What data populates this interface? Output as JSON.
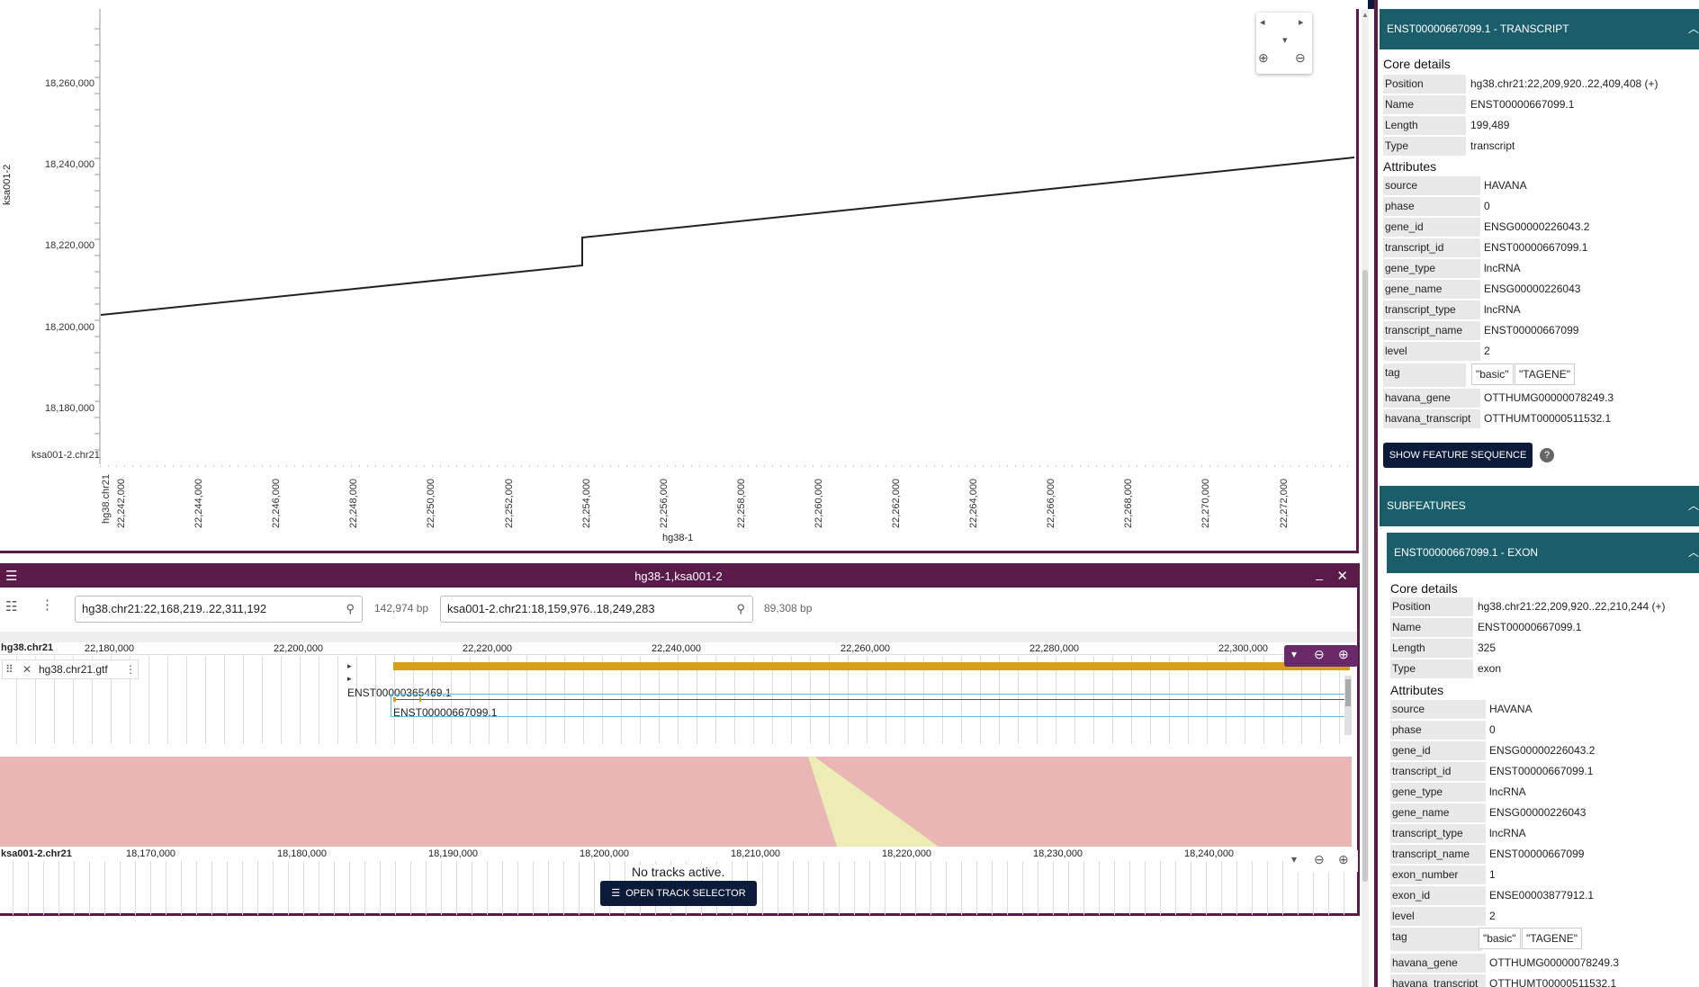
{
  "dotplot": {
    "y_axis_label": "ksa001-2",
    "y_ticks": [
      "18,260,000",
      "18,240,000",
      "18,220,000",
      "18,200,000",
      "18,180,000"
    ],
    "y_ref_label": "ksa001-2.chr21",
    "x_ref_label": "hg38.chr21",
    "x_ticks": [
      "22,242,000",
      "22,244,000",
      "22,246,000",
      "22,248,000",
      "22,250,000",
      "22,252,000",
      "22,254,000",
      "22,256,000",
      "22,258,000",
      "22,260,000",
      "22,262,000",
      "22,264,000",
      "22,266,000",
      "22,268,000",
      "22,270,000",
      "22,272,000"
    ],
    "x_axis_label": "hg38-1"
  },
  "lgv": {
    "title": "hg38-1,ksa001-2",
    "loc1": "hg38.chr21:22,168,219..22,311,192",
    "bp1": "142,974 bp",
    "loc2": "ksa001-2.chr21:18,159,976..18,249,283",
    "bp2": "89,308 bp",
    "top_ref": "hg38.chr21",
    "top_ticks": [
      "22,180,000",
      "22,200,000",
      "22,220,000",
      "22,240,000",
      "22,260,000",
      "22,280,000",
      "22,300,000"
    ],
    "track_name": "hg38.chr21.gtf",
    "feature1": "ENST00000365469.1",
    "feature2": "ENST00000667099.1",
    "bottom_ref": "ksa001-2.chr21",
    "bottom_ticks": [
      "18,170,000",
      "18,180,000",
      "18,190,000",
      "18,200,000",
      "18,210,000",
      "18,220,000",
      "18,230,000",
      "18,240,000"
    ],
    "no_tracks": "No tracks active.",
    "open_selector": "OPEN TRACK SELECTOR"
  },
  "panel": {
    "header1": "ENST00000667099.1 - TRANSCRIPT",
    "core_details": "Core details",
    "core": [
      {
        "k": "Position",
        "v": "hg38.chr21:22,209,920..22,409,408 (+)"
      },
      {
        "k": "Name",
        "v": "ENST00000667099.1"
      },
      {
        "k": "Length",
        "v": "199,489"
      },
      {
        "k": "Type",
        "v": "transcript"
      }
    ],
    "attributes": "Attributes",
    "attrs": [
      {
        "k": "source",
        "v": "HAVANA"
      },
      {
        "k": "phase",
        "v": "0"
      },
      {
        "k": "gene_id",
        "v": "ENSG00000226043.2"
      },
      {
        "k": "transcript_id",
        "v": "ENST00000667099.1"
      },
      {
        "k": "gene_type",
        "v": "lncRNA"
      },
      {
        "k": "gene_name",
        "v": "ENSG00000226043"
      },
      {
        "k": "transcript_type",
        "v": "lncRNA"
      },
      {
        "k": "transcript_name",
        "v": "ENST00000667099"
      },
      {
        "k": "level",
        "v": "2"
      }
    ],
    "tag_key": "tag",
    "tags": [
      "\"basic\"",
      "\"TAGENE\""
    ],
    "attrs2": [
      {
        "k": "havana_gene",
        "v": "OTTHUMG00000078249.3"
      },
      {
        "k": "havana_transcript",
        "v": "OTTHUMT00000511532.1"
      }
    ],
    "show_seq": "SHOW FEATURE SEQUENCE",
    "subfeatures": "SUBFEATURES",
    "exon_header": "ENST00000667099.1 - EXON",
    "exon_core": [
      {
        "k": "Position",
        "v": "hg38.chr21:22,209,920..22,210,244 (+)"
      },
      {
        "k": "Name",
        "v": "ENST00000667099.1"
      },
      {
        "k": "Length",
        "v": "325"
      },
      {
        "k": "Type",
        "v": "exon"
      }
    ],
    "exon_attrs": [
      {
        "k": "source",
        "v": "HAVANA"
      },
      {
        "k": "phase",
        "v": "0"
      },
      {
        "k": "gene_id",
        "v": "ENSG00000226043.2"
      },
      {
        "k": "transcript_id",
        "v": "ENST00000667099.1"
      },
      {
        "k": "gene_type",
        "v": "lncRNA"
      },
      {
        "k": "gene_name",
        "v": "ENSG00000226043"
      },
      {
        "k": "transcript_type",
        "v": "lncRNA"
      },
      {
        "k": "transcript_name",
        "v": "ENST00000667099"
      },
      {
        "k": "exon_number",
        "v": "1"
      },
      {
        "k": "exon_id",
        "v": "ENSE00003877912.1"
      },
      {
        "k": "level",
        "v": "2"
      }
    ],
    "exon_attrs2": [
      {
        "k": "havana_gene",
        "v": "OTTHUMG00000078249.3"
      },
      {
        "k": "havana_transcript",
        "v": "OTTHUMT00000511532.1"
      }
    ]
  }
}
